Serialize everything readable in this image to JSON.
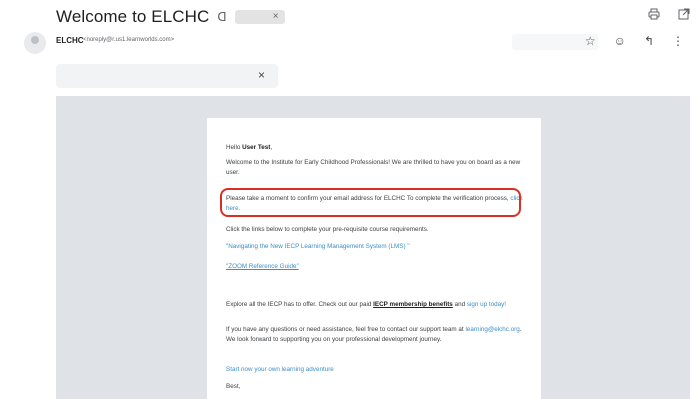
{
  "email": {
    "subject": "Welcome to ELCHC",
    "label_icon": "ᗡ",
    "label_chip_close": "×",
    "sender_name": "ELCHC",
    "sender_email": "<noreply@r.us1.learnworlds.com>",
    "banner_close": "×"
  },
  "body": {
    "greeting_prefix": "Hello ",
    "greeting_name": "User Test",
    "greeting_suffix": ",",
    "intro": "Welcome to the Institute for Early Childhood Professionals! We are thrilled to have you on board as a new user.",
    "confirm_text": "Please take a moment to confirm your email address for ELCHC To complete the verification process,",
    "confirm_link": "click here.",
    "prereq": "Click the links below to complete your pre-requisite course requirements.",
    "link_lms": "\"Navigating the New IECP Learning Management System (LMS) \"",
    "link_zoom": "\"ZOOM Reference Guide\"",
    "explore_text": "Explore all the IECP has to offer. Check out our paid",
    "explore_bold": "IECP membership benefits",
    "explore_and": "and",
    "signup_link": "sign up today!",
    "questions_text": "If you have any questions or need assistance, feel free to contact our support team at",
    "support_email": "learning@elchc.org",
    "questions_rest": ". We look forward to supporting you on your professional development journey.",
    "adventure_link": "Start now your own learning adventure",
    "closing": "Best,"
  }
}
